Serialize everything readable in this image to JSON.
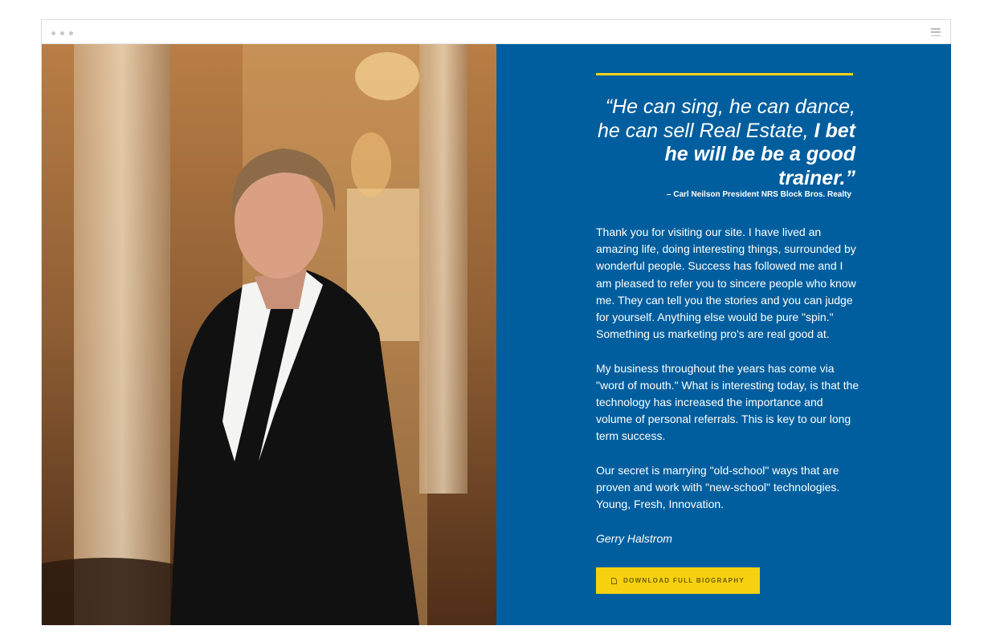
{
  "page": {
    "quote_light": "“He can sing, he can dance, he can sell Real Estate,",
    "quote_bold": "I bet he will be be a good trainer.”",
    "attribution": "– Carl Neilson President NRS Block Bros. Realty",
    "paragraphs": [
      "Thank you for visiting our site. I have lived an amazing life, doing interesting things, surrounded by wonderful people. Success has followed me and I am pleased to refer you to sincere people who know me. They can tell you the stories and you can judge for yourself. Anything else would be pure \"spin.\" Something us marketing pro's are real good at.",
      "My business throughout the years has come via \"word of mouth.\" What is interesting today, is that the technology has increased the importance and volume of personal referrals. This is key to our long term success.",
      "Our secret is marrying \"old-school\" ways that are proven and work with \"new-school\" technologies. Young, Fresh, Innovation."
    ],
    "signature": "Gerry Halstrom",
    "download_label": "DOWNLOAD FULL BIOGRAPHY",
    "download_icon": "document-icon"
  },
  "colors": {
    "panel_bg": "#015e9e",
    "accent_yellow": "#f4d21a",
    "button_bg": "#f7d10f"
  }
}
